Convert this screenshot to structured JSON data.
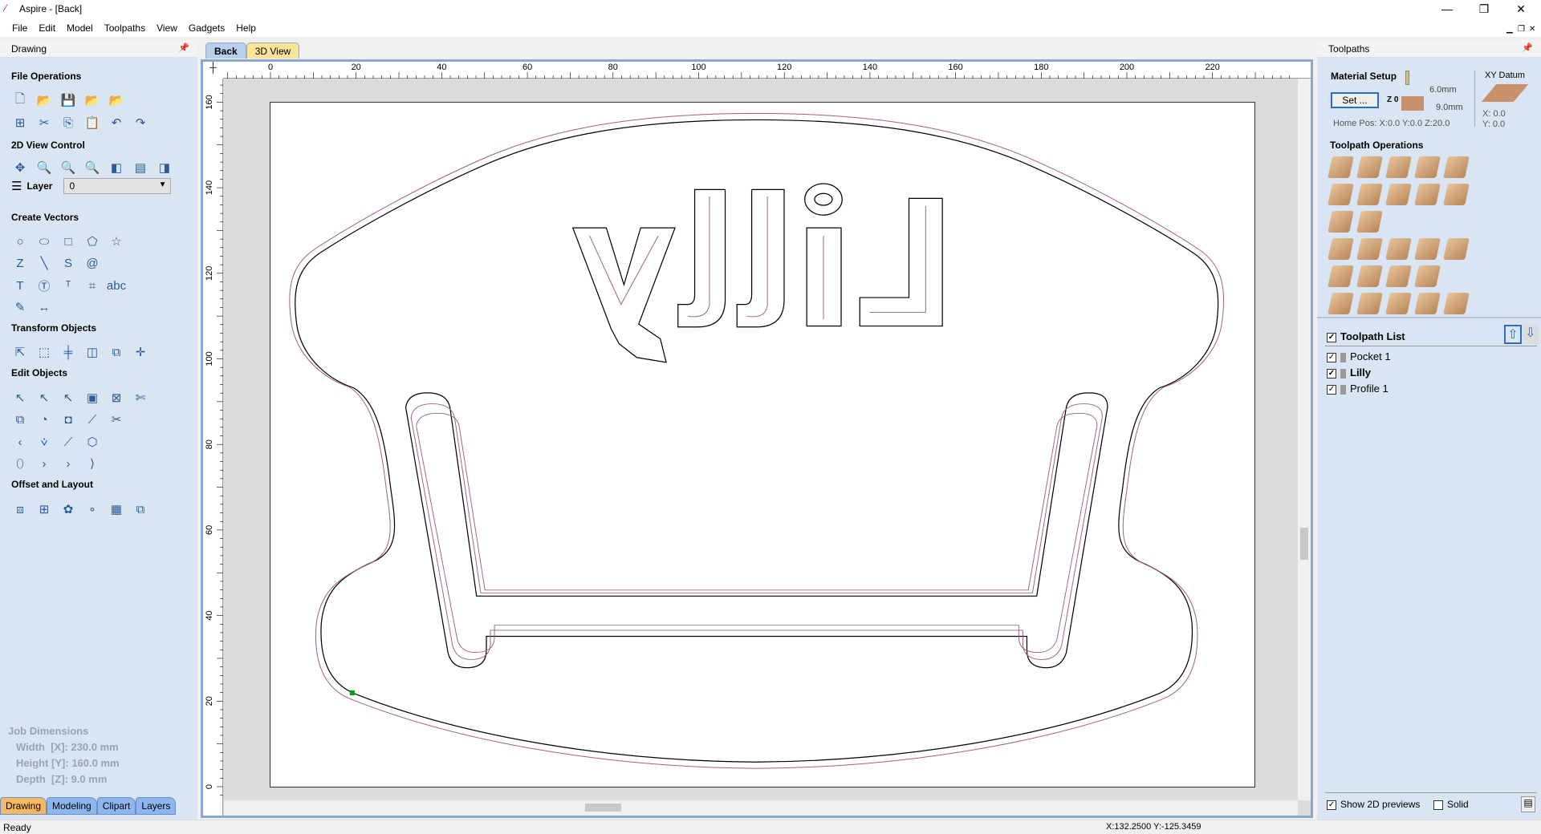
{
  "window": {
    "title": "Aspire - [Back]",
    "minimize": "—",
    "restore": "❐",
    "close": "✕"
  },
  "menu": [
    "File",
    "Edit",
    "Model",
    "Toolpaths",
    "View",
    "Gadgets",
    "Help"
  ],
  "mdi": {
    "minimize": "▁",
    "restore": "❐",
    "close": "✕"
  },
  "left": {
    "title": "Drawing",
    "sections": [
      {
        "title": "File Operations",
        "rows": [
          [
            "new-file-icon",
            "open-folder-icon",
            "save-icon",
            "open-recent-icon",
            "import-icon"
          ],
          [
            "select-all-icon",
            "cut-icon",
            "copy-icon",
            "paste-icon",
            "undo-icon",
            "redo-icon"
          ]
        ]
      },
      {
        "title": "2D View Control",
        "rows": [
          [
            "pan-icon",
            "zoom-box-icon",
            "zoom-fit-icon",
            "zoom-selection-icon",
            "view-left-icon",
            "view-center-icon",
            "view-right-icon"
          ]
        ]
      },
      {
        "title": "Create Vectors",
        "rows": [
          [
            "circle-icon",
            "ellipse-icon",
            "rectangle-icon",
            "polygon-icon",
            "star-icon"
          ],
          [
            "polyline-icon",
            "line-icon",
            "spline-icon",
            "spiral-icon"
          ],
          [
            "text-icon",
            "text-box-icon",
            "text-on-curve-icon",
            "bitmap-trace-icon",
            "text-autolayout-icon"
          ],
          [
            "dimension-icon",
            "measure-icon"
          ]
        ]
      },
      {
        "title": "Transform Objects",
        "rows": [
          [
            "move-icon",
            "scale-icon",
            "align-icon",
            "mirror-icon",
            "distort-icon",
            "set-origin-icon"
          ]
        ]
      },
      {
        "title": "Edit Objects",
        "rows": [
          [
            "select-icon",
            "node-edit-icon",
            "interactive-select-icon",
            "group-icon",
            "ungroup-icon",
            "trim-icon"
          ],
          [
            "weld-icon",
            "subtract-icon",
            "intersect-icon",
            "join-icon",
            "scissors-icon"
          ],
          [
            "curve-fit-icon",
            "fillet-icon",
            "line-fit-icon",
            "close-vector-icon"
          ],
          [
            "smooth-icon",
            "extend-icon",
            "chevron-icon",
            "break-icon"
          ]
        ]
      },
      {
        "title": "Offset and Layout",
        "rows": [
          [
            "offset-icon",
            "array-icon",
            "circular-array-icon",
            "path-array-icon",
            "nesting-icon",
            "fit-to-icon"
          ]
        ]
      }
    ],
    "layer": {
      "label": "Layer",
      "value": "0"
    },
    "job": {
      "title": "Job Dimensions",
      "width": "Width  [X]: 230.0 mm",
      "height": "Height [Y]: 160.0 mm",
      "depth": "Depth  [Z]: 9.0 mm"
    },
    "tabs": [
      "Drawing",
      "Modeling",
      "Clipart",
      "Layers"
    ]
  },
  "view_tabs": [
    "Back",
    "3D View"
  ],
  "rulers": {
    "x": [
      "0",
      "20",
      "40",
      "60",
      "80",
      "100",
      "120",
      "140",
      "160",
      "180",
      "200",
      "220"
    ],
    "y": [
      "160",
      "140",
      "120",
      "100",
      "80",
      "60",
      "40",
      "20",
      "0"
    ]
  },
  "drawing": {
    "text": "Lilly",
    "line_color": "#000000",
    "toolpath_color": "#a0607a",
    "origin_color": "#119911"
  },
  "right": {
    "title": "Toolpaths",
    "material": {
      "title": "Material Setup",
      "set": "Set ...",
      "z0": "Z 0",
      "top": "6.0mm",
      "thick": "9.0mm",
      "home": "Home Pos:  X:0.0 Y:0.0 Z:20.0"
    },
    "datum": {
      "title": "XY Datum",
      "x": "X: 0.0",
      "y": "Y: 0.0"
    },
    "ops_title": "Toolpath Operations",
    "ops": [
      [
        "profile-icon",
        "pocket-icon",
        "drilling-icon",
        "quick-engrave-icon",
        "inlay-icon"
      ],
      [
        "v-carve-icon",
        "fluting-icon",
        "texture-icon",
        "prism-icon",
        "moulding-icon"
      ],
      [
        "3d-roughing-icon",
        "3d-finishing-icon"
      ],
      [
        "toolpath-template-icon",
        "edit-toolpath-icon",
        "copy-toolpath-icon",
        "delete-toolpath-icon",
        "calculator-icon"
      ],
      [
        "preview-all-icon",
        "preview-selected-icon",
        "merge-icon",
        "vectric-icon"
      ],
      [
        "material-icon",
        "time-estimate-icon",
        "tool-database-icon",
        "save-toolpath-icon",
        "reset-preview-icon"
      ]
    ],
    "list_title": "Toolpath List",
    "items": [
      {
        "name": "Pocket 1",
        "checked": true,
        "bold": false
      },
      {
        "name": "Lilly",
        "checked": true,
        "bold": true
      },
      {
        "name": "Profile 1",
        "checked": true,
        "bold": false
      }
    ],
    "show_previews": "Show 2D previews",
    "solid": "Solid"
  },
  "status": {
    "text": "Ready",
    "coords": "X:132.2500 Y:-125.3459"
  }
}
